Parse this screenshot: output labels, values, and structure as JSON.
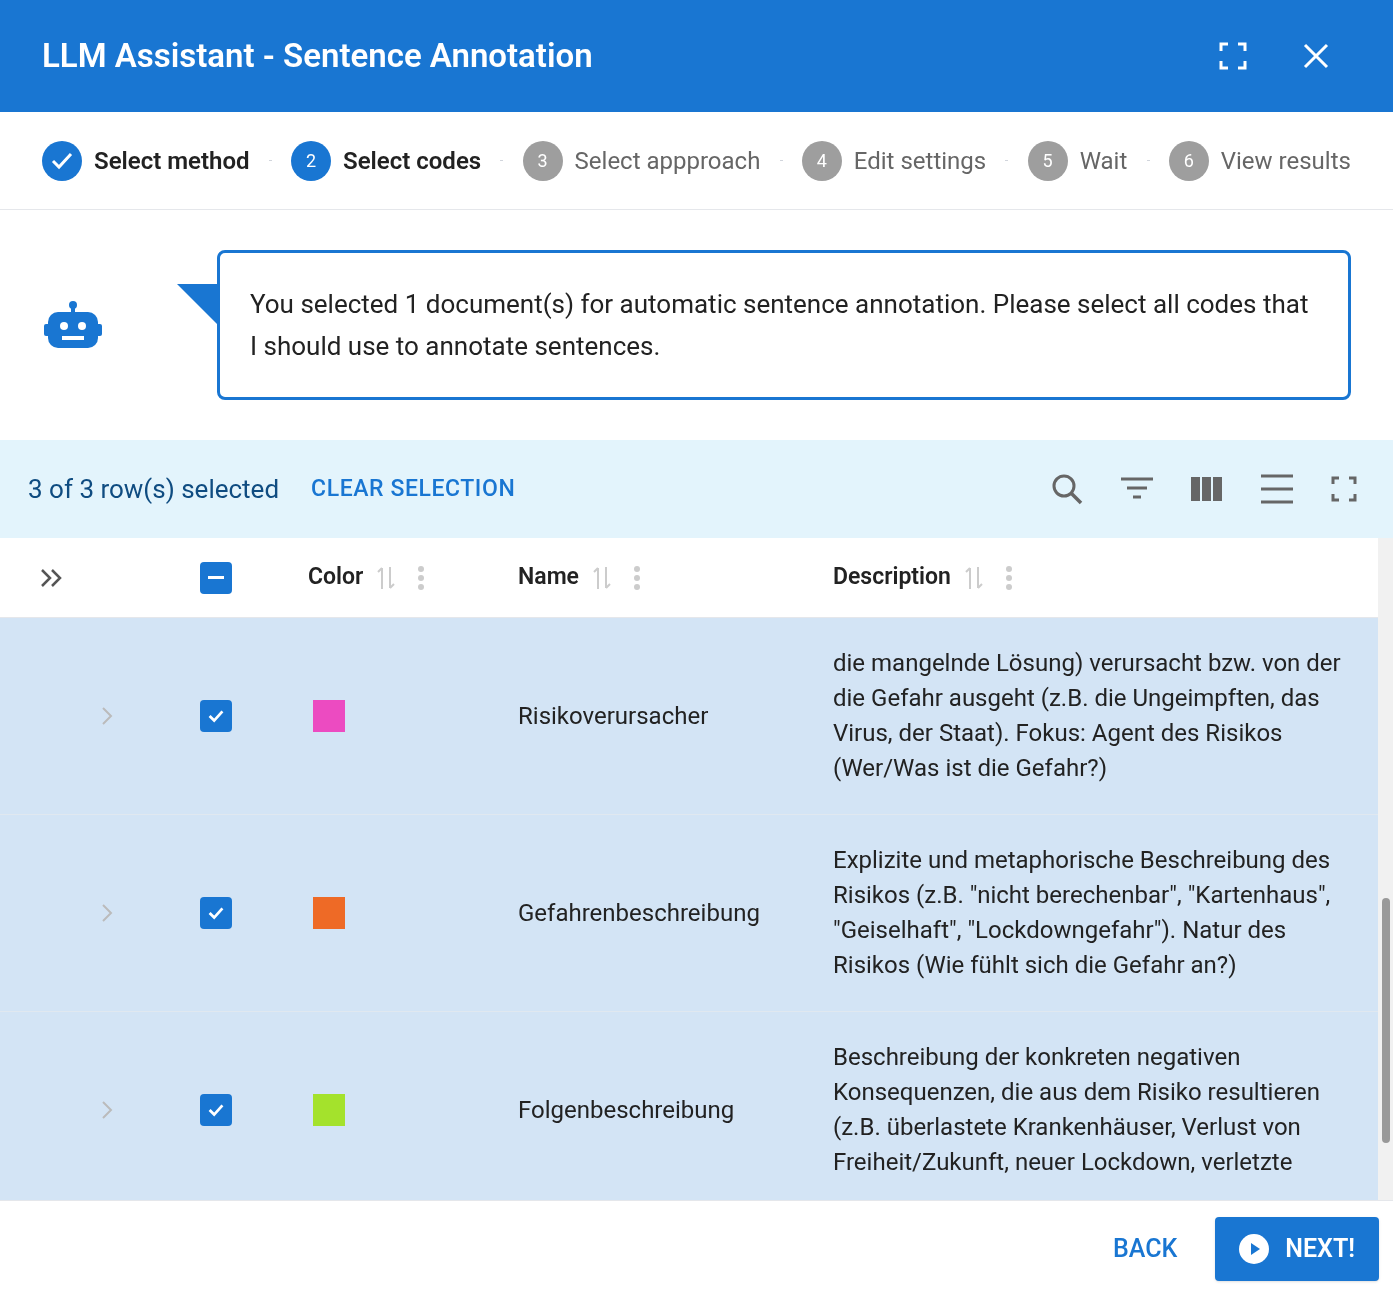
{
  "window": {
    "title": "LLM Assistant - Sentence Annotation"
  },
  "steps": [
    {
      "label": "Select method",
      "completed": true,
      "active": false
    },
    {
      "number": "2",
      "label": "Select codes",
      "completed": false,
      "active": true
    },
    {
      "number": "3",
      "label": "Select appproach",
      "completed": false,
      "active": false
    },
    {
      "number": "4",
      "label": "Edit settings",
      "completed": false,
      "active": false
    },
    {
      "number": "5",
      "label": "Wait",
      "completed": false,
      "active": false
    },
    {
      "number": "6",
      "label": "View results",
      "completed": false,
      "active": false
    }
  ],
  "message": "You selected 1 document(s) for automatic sentence annotation. Please select all codes that I should use to annotate sentences.",
  "toolbar": {
    "selection_count": "3 of 3 row(s) selected",
    "clear_button": "CLEAR SELECTION"
  },
  "table": {
    "header_indeterminate": true,
    "columns": [
      "Color",
      "Name",
      "Description"
    ],
    "rows": [
      {
        "checked": true,
        "color": "#ec4bc1",
        "name": "Risikoverursacher",
        "description": "die mangelnde Lösung) verursacht bzw. von der die Gefahr ausgeht (z.B. die Ungeimpften, das Virus, der Staat). Fokus: Agent des Risikos (Wer/Was ist die Gefahr?)"
      },
      {
        "checked": true,
        "color": "#ee6a26",
        "name": "Gefahrenbeschreibung",
        "description": "Explizite und metaphorische Beschreibung des Risikos (z.B. \"nicht berechenbar\", \"Kartenhaus\", \"Geiselhaft\", \"Lockdowngefahr\"). Natur des Risikos (Wie fühlt sich die Gefahr an?)"
      },
      {
        "checked": true,
        "color": "#a4e22c",
        "name": "Folgenbeschreibung",
        "description": "Beschreibung der konkreten negativen Konsequenzen, die aus dem Risiko resultieren (z.B. überlastete Krankenhäuser, Verlust von Freiheit/Zukunft, neuer Lockdown, verletzte"
      }
    ]
  },
  "footer": {
    "back": "BACK",
    "next": "NEXT!"
  }
}
